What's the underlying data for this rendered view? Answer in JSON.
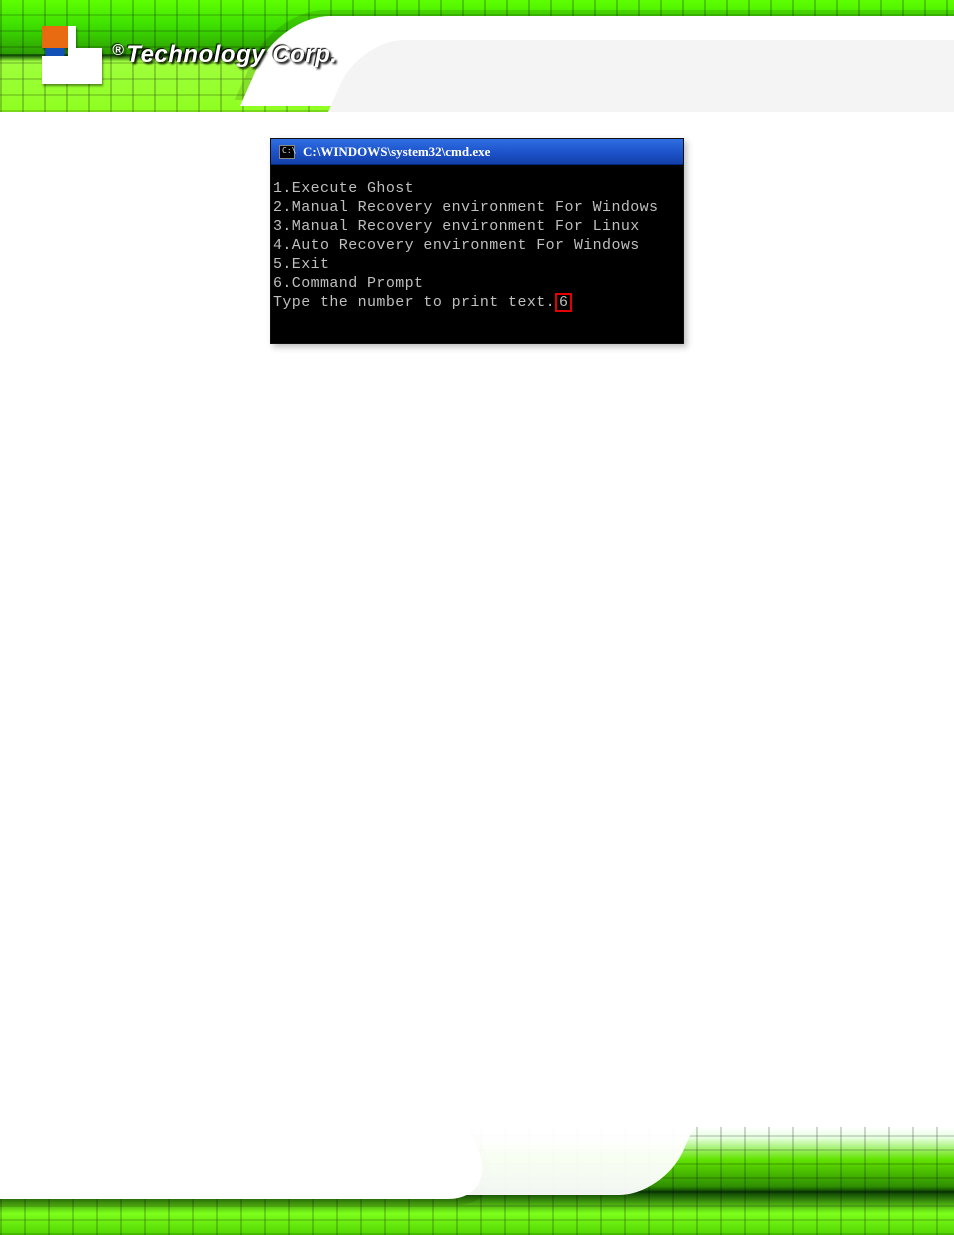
{
  "brand": {
    "registered_mark": "®",
    "company_text": "Technology Corp."
  },
  "cmd": {
    "icon_text": "C:\\",
    "title": "C:\\WINDOWS\\system32\\cmd.exe",
    "options": [
      "1.Execute Ghost",
      "2.Manual Recovery environment For Windows",
      "3.Manual Recovery environment For Linux",
      "4.Auto Recovery environment For Windows",
      "5.Exit",
      "6.Command Prompt"
    ],
    "prompt_text": "Type the number to print text.",
    "selected_value": "6"
  },
  "colors": {
    "title_bar_gradient": [
      "#2f6fe3",
      "#1340a9"
    ],
    "highlight_border": "#e40000",
    "terminal_bg": "#000000",
    "terminal_fg": "#bfbfbf",
    "banner_greens": [
      "#5eff00",
      "#2d9c00",
      "#073a05",
      "#9fff3c"
    ]
  }
}
